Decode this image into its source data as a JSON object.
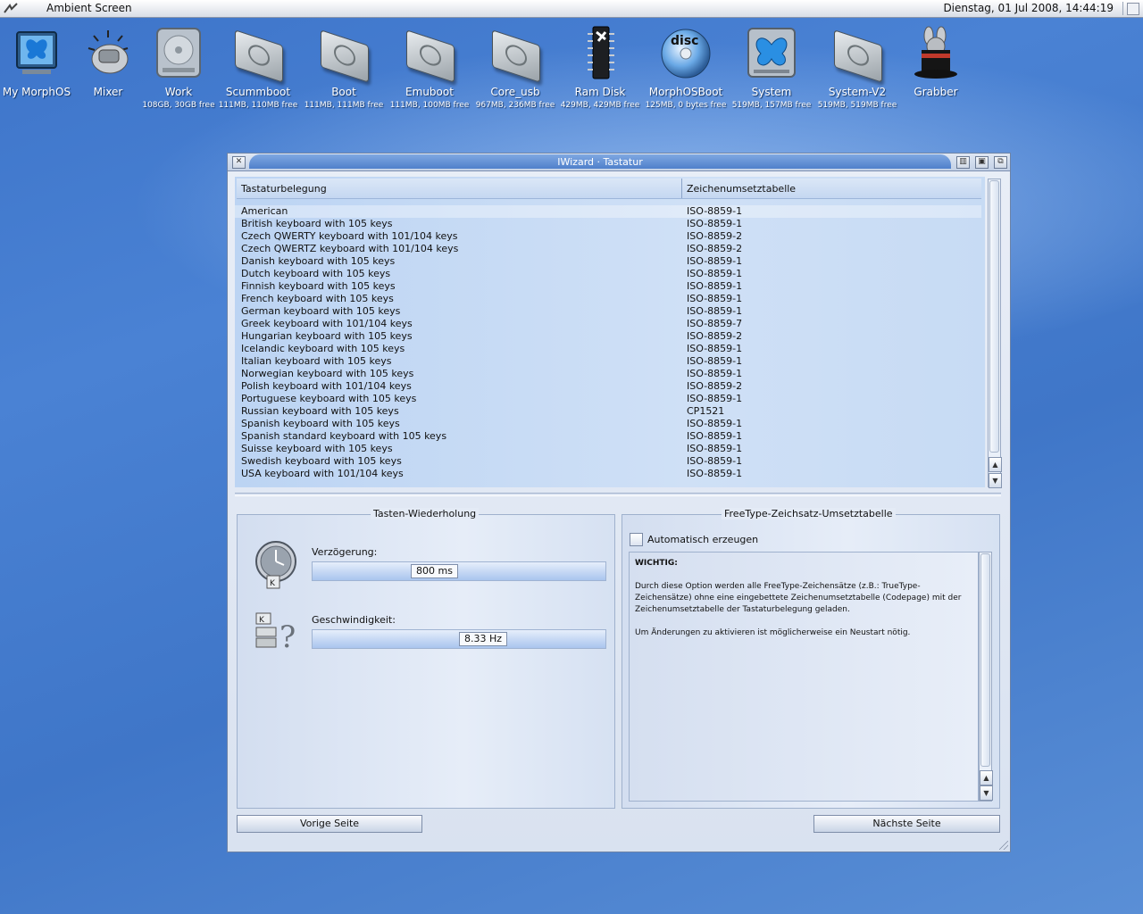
{
  "menubar": {
    "title": "Ambient Screen",
    "clock": "Dienstag, 01 Jul 2008, 14:44:19"
  },
  "desktop": {
    "icons": [
      {
        "label": "My MorphOS",
        "sub": ""
      },
      {
        "label": "Mixer",
        "sub": ""
      },
      {
        "label": "Work",
        "sub": "108GB, 30GB free"
      },
      {
        "label": "Scummboot",
        "sub": "111MB, 110MB free"
      },
      {
        "label": "Boot",
        "sub": "111MB, 111MB free"
      },
      {
        "label": "Emuboot",
        "sub": "111MB, 100MB free"
      },
      {
        "label": "Core_usb",
        "sub": "967MB, 236MB free"
      },
      {
        "label": "Ram Disk",
        "sub": "429MB, 429MB free"
      },
      {
        "label": "MorphOSBoot",
        "sub": "125MB, 0 bytes free"
      },
      {
        "label": "System",
        "sub": "519MB, 157MB free"
      },
      {
        "label": "System-V2",
        "sub": "519MB, 519MB free"
      },
      {
        "label": "Grabber",
        "sub": ""
      }
    ],
    "disc_text": "disc"
  },
  "window": {
    "title": "IWizard · Tastatur",
    "list": {
      "headers": [
        "Tastaturbelegung",
        "Zeichenumsetztabelle"
      ],
      "rows": [
        [
          "American",
          "ISO-8859-1"
        ],
        [
          "British keyboard with 105 keys",
          "ISO-8859-1"
        ],
        [
          "Czech QWERTY keyboard with 101/104 keys",
          "ISO-8859-2"
        ],
        [
          "Czech QWERTZ keyboard with 101/104 keys",
          "ISO-8859-2"
        ],
        [
          "Danish keyboard with 105 keys",
          "ISO-8859-1"
        ],
        [
          "Dutch keyboard with 105 keys",
          "ISO-8859-1"
        ],
        [
          "Finnish keyboard with 105 keys",
          "ISO-8859-1"
        ],
        [
          "French keyboard with 105 keys",
          "ISO-8859-1"
        ],
        [
          "German keyboard with 105 keys",
          "ISO-8859-1"
        ],
        [
          "Greek keyboard with 101/104 keys",
          "ISO-8859-7"
        ],
        [
          "Hungarian keyboard with 105 keys",
          "ISO-8859-2"
        ],
        [
          "Icelandic keyboard with 105 keys",
          "ISO-8859-1"
        ],
        [
          "Italian keyboard with 105 keys",
          "ISO-8859-1"
        ],
        [
          "Norwegian keyboard with 105 keys",
          "ISO-8859-1"
        ],
        [
          "Polish keyboard with 101/104 keys",
          "ISO-8859-2"
        ],
        [
          "Portuguese keyboard with 105 keys",
          "ISO-8859-1"
        ],
        [
          "Russian keyboard with 105 keys",
          "CP1521"
        ],
        [
          "Spanish keyboard with 105 keys",
          "ISO-8859-1"
        ],
        [
          "Spanish standard keyboard with 105 keys",
          "ISO-8859-1"
        ],
        [
          "Suisse keyboard with 105 keys",
          "ISO-8859-1"
        ],
        [
          "Swedish keyboard with 105 keys",
          "ISO-8859-1"
        ],
        [
          "USA keyboard with 101/104 keys",
          "ISO-8859-1"
        ]
      ]
    },
    "repeat": {
      "title": "Tasten-Wiederholung",
      "delay_label": "Verzögerung:",
      "delay_value": "800 ms",
      "speed_label": "Geschwindigkeit:",
      "speed_value": "8.33 Hz",
      "key_glyph": "K",
      "question_glyph": "?"
    },
    "freetype": {
      "title": "FreeType-Zeichsatz-Umsetztabelle",
      "checkbox_label": "Automatisch erzeugen",
      "checkbox_checked": false,
      "info_heading": "WICHTIG:",
      "info_p1": "Durch diese Option werden alle FreeType-Zeichensätze (z.B.: TrueType-Zeichensätze) ohne eine eingebettete Zeichenumsetztabelle (Codepage) mit der Zeichenumsetztabelle der Tastaturbelegung geladen.",
      "info_p2": "Um Änderungen zu aktivieren ist möglicherweise ein Neustart nötig."
    },
    "buttons": {
      "prev": "Vorige Seite",
      "next": "Nächste Seite"
    }
  }
}
